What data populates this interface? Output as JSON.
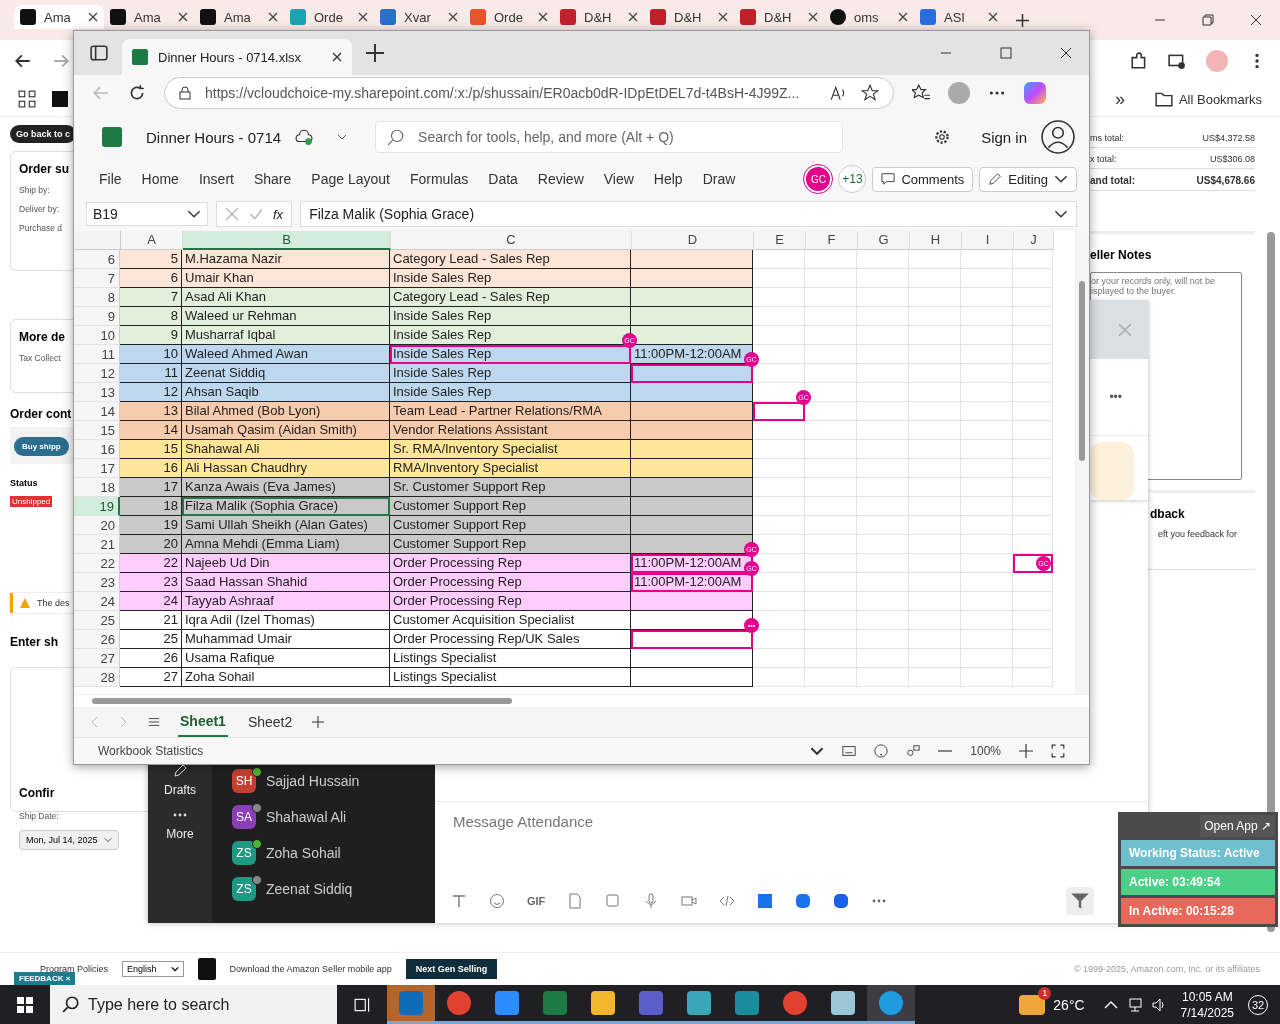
{
  "browser": {
    "tabs": [
      {
        "label": "Ama",
        "selected": true
      },
      {
        "label": "Ama",
        "selected": false
      },
      {
        "label": "Ama",
        "selected": false
      },
      {
        "label": "Orde",
        "selected": false
      },
      {
        "label": "Xvar",
        "selected": false
      },
      {
        "label": "Orde",
        "selected": false
      },
      {
        "label": "D&H",
        "selected": false
      },
      {
        "label": "D&H",
        "selected": false
      },
      {
        "label": "D&H",
        "selected": false
      },
      {
        "label": "oms",
        "selected": false
      },
      {
        "label": "ASI",
        "selected": false
      }
    ],
    "bookmarks_overflow": "»",
    "bookmarks_folder": "All Bookmarks"
  },
  "amazon": {
    "back_button": "Go back to c",
    "order_summary": {
      "title": "Order su",
      "fields": [
        "Ship by:",
        "Deliver by:",
        "Purchase d"
      ]
    },
    "more_details": {
      "title": "More de",
      "fields": [
        "Tax Collect"
      ]
    },
    "order_contents": {
      "title": "Order cont",
      "button": "Buy shipp",
      "status_label": "Status",
      "status": "Unshipped"
    },
    "alert": "The des",
    "enter_shipping": "Enter sh",
    "confirm": {
      "title": "Confir",
      "ship_date_label": "Ship Date:",
      "ship_date": "Mon, Jul 14, 2025"
    },
    "totals": [
      {
        "label": "ms total:",
        "value": "US$4,372.58",
        "bold": false
      },
      {
        "label": "x total:",
        "value": "US$306.08",
        "bold": false
      },
      {
        "label": "and total:",
        "value": "US$4,678.66",
        "bold": true
      }
    ],
    "seller_notes": {
      "title": "eller Notes",
      "placeholder": "or your records only, will not be\nisplayed to the buyer."
    },
    "feedback": {
      "title": "dback",
      "text": "eft you feedback for"
    },
    "footer": {
      "links": [
        "Program Policies"
      ],
      "language": "English",
      "app_link": "Download the Amazon Seller mobile app",
      "next_gen": "Next Gen Selling",
      "feedback_tab": "FEEDBACK ×",
      "copyright": "© 1999-2025, Amazon.com, Inc. or its affiliates"
    }
  },
  "edge": {
    "tab": "Dinner Hours - 0714.xlsx",
    "url": "https://vcloudchoice-my.sharepoint.com/:x:/p/shussain/ER0acb0dR-IDpEtDEL7d-t4BsH-4J99Z..."
  },
  "excel": {
    "title": "Dinner Hours - 0714",
    "search": {
      "placeholder": "Search for tools, help, and more (Alt + Q)"
    },
    "sign_in": "Sign in",
    "menu": [
      "File",
      "Home",
      "Insert",
      "Share",
      "Page Layout",
      "Formulas",
      "Data",
      "Review",
      "View",
      "Help",
      "Draw"
    ],
    "collaborator": "GC",
    "others": "+13",
    "comments": "Comments",
    "editing": "Editing",
    "name_box": "B19",
    "fx": "fx",
    "formula": "Filza Malik (Sophia Grace)",
    "columns": [
      {
        "label": "A",
        "selected": false
      },
      {
        "label": "B",
        "selected": true
      },
      {
        "label": "C",
        "selected": false
      },
      {
        "label": "D",
        "selected": false
      },
      {
        "label": "E",
        "selected": false
      },
      {
        "label": "F",
        "selected": false
      },
      {
        "label": "G",
        "selected": false
      },
      {
        "label": "H",
        "selected": false
      },
      {
        "label": "I",
        "selected": false
      },
      {
        "label": "J",
        "selected": false
      }
    ],
    "rows": [
      {
        "number": "6",
        "a": "5",
        "b": "M.Hazama Nazir",
        "c": "Category Lead - Sales Rep",
        "color": "#fce4d6",
        "selected": false
      },
      {
        "number": "7",
        "a": "6",
        "b": "Umair Khan",
        "c": "Inside Sales Rep",
        "color": "#fce4d6",
        "selected": false
      },
      {
        "number": "8",
        "a": "7",
        "b": "Asad Ali Khan",
        "c": "Category Lead - Sales Rep",
        "color": "#e2efda",
        "selected": false
      },
      {
        "number": "9",
        "a": "8",
        "b": "Waleed ur Rehman",
        "c": "Inside Sales Rep",
        "color": "#e2efda",
        "selected": false
      },
      {
        "number": "10",
        "a": "9",
        "b": "Musharraf Iqbal",
        "c": "Inside Sales Rep",
        "color": "#e2efda",
        "selected": false
      },
      {
        "number": "11",
        "a": "10",
        "b": "Waleed Ahmed Awan",
        "c": "Inside Sales Rep",
        "d": "11:00PM-12:00AM",
        "color": "#bdd7ee",
        "selected": false,
        "cursor_c": "GC"
      },
      {
        "number": "12",
        "a": "11",
        "b": "Zeenat Siddiq",
        "c": "Inside Sales Rep",
        "color": "#bdd7ee",
        "selected": false,
        "cursor_d": "GC"
      },
      {
        "number": "13",
        "a": "12",
        "b": "Ahsan Saqib",
        "c": "Inside Sales Rep",
        "color": "#bdd7ee",
        "selected": false
      },
      {
        "number": "14",
        "a": "13",
        "b": "Bilal Ahmed (Bob Lyon)",
        "c": "Team Lead - Partner Relations/RMA",
        "color": "#f8cbad",
        "selected": false,
        "cursor_e": "GC"
      },
      {
        "number": "15",
        "a": "14",
        "b": "Usamah Qasim (Aidan Smith)",
        "c": "Vendor Relations Assistant",
        "color": "#f8cbad",
        "selected": false
      },
      {
        "number": "16",
        "a": "15",
        "b": "Shahawal Ali",
        "c": "Sr. RMA/Inventory Specialist",
        "color": "#ffe699",
        "selected": false
      },
      {
        "number": "17",
        "a": "16",
        "b": "Ali Hassan Chaudhry",
        "c": "RMA/Inventory Specialist",
        "color": "#ffe699",
        "selected": false
      },
      {
        "number": "18",
        "a": "17",
        "b": "Kanza Awais (Eva James)",
        "c": "Sr. Customer Support Rep",
        "color": "#c9c9c9",
        "selected": false
      },
      {
        "number": "19",
        "a": "18",
        "b": "Filza Malik (Sophia Grace)",
        "c": "Customer Support Rep",
        "color": "#c9c9c9",
        "selected": true
      },
      {
        "number": "20",
        "a": "19",
        "b": "Sami Ullah Sheikh (Alan Gates)",
        "c": "Customer Support Rep",
        "color": "#c9c9c9",
        "selected": false
      },
      {
        "number": "21",
        "a": "20",
        "b": "Amna Mehdi (Emma Liam)",
        "c": "Customer Support Rep",
        "color": "#c9c9c9",
        "selected": false
      },
      {
        "number": "22",
        "a": "22",
        "b": "Najeeb Ud Din",
        "c": "Order Processing Rep",
        "d": "11:00PM-12:00AM",
        "color": "#ffccff",
        "selected": false,
        "cursor_d": "GC",
        "cursor_j": "GC"
      },
      {
        "number": "23",
        "a": "23",
        "b": "Saad Hassan Shahid",
        "c": "Order Processing Rep",
        "d": "11:00PM-12:00AM",
        "color": "#ffccff",
        "selected": false,
        "cursor_d": "GC"
      },
      {
        "number": "24",
        "a": "24",
        "b": "Tayyab Ashraaf",
        "c": "Order Processing Rep",
        "color": "#ffccff",
        "selected": false
      },
      {
        "number": "25",
        "a": "21",
        "b": "Iqra Adil (Izel Thomas)",
        "c": "Customer Acquisition Specialist",
        "color": "#ffffff",
        "selected": false
      },
      {
        "number": "26",
        "a": "25",
        "b": "Muhammad Umair",
        "c": "Order Processing Rep/UK Sales",
        "color": "#ffffff",
        "selected": false,
        "cursor_d": "•••"
      },
      {
        "number": "27",
        "a": "26",
        "b": "Usama Rafique",
        "c": "Listings Specialist",
        "color": "#ffffff",
        "selected": false
      },
      {
        "number": "28",
        "a": "27",
        "b": "Zoha Sohail",
        "c": "Listings Specialist",
        "color": "#ffffff",
        "selected": false
      }
    ],
    "sheets": [
      {
        "label": "Sheet1",
        "selected": true
      },
      {
        "label": "Sheet2",
        "selected": false
      }
    ],
    "status": "Workbook Statistics",
    "zoom": "100%"
  },
  "teams": {
    "nav": [
      "Drafts",
      "More"
    ],
    "contacts": [
      {
        "initials": "SH",
        "name": "Sajjad Hussain",
        "color": "#c4402f",
        "available": true
      },
      {
        "initials": "SA",
        "name": "Shahawal Ali",
        "color": "#8a3fb8",
        "available": false
      },
      {
        "initials": "ZS",
        "name": "Zoha Sohail",
        "color": "#1e9a84",
        "available": true
      },
      {
        "initials": "ZS",
        "name": "Zeenat Siddiq",
        "color": "#1e9a84",
        "available": false
      }
    ],
    "composer": {
      "placeholder": "Message Attendance"
    },
    "gif": "GIF",
    "more": "•••"
  },
  "attendance": {
    "open": "Open App ↗",
    "status": "Working Status: Active",
    "active": "Active: 03:49:54",
    "inactive": "In Active: 00:15:28"
  },
  "taskbar": {
    "search": {
      "placeholder": "Type here to search"
    },
    "apps": [
      {
        "kind": "mail",
        "selected": false,
        "highlighted": true
      },
      {
        "kind": "browser",
        "selected": false,
        "highlighted": false
      },
      {
        "kind": "video",
        "selected": false,
        "highlighted": false
      },
      {
        "kind": "sheet",
        "selected": false,
        "highlighted": false
      },
      {
        "kind": "folder",
        "selected": false,
        "highlighted": false
      },
      {
        "kind": "chat",
        "selected": false,
        "highlighted": false
      },
      {
        "kind": "cube",
        "selected": false,
        "highlighted": false
      },
      {
        "kind": "shield",
        "selected": false,
        "highlighted": false
      },
      {
        "kind": "browser",
        "selected": false,
        "highlighted": false
      },
      {
        "kind": "notepad",
        "selected": false,
        "highlighted": false
      },
      {
        "kind": "edge",
        "selected": true,
        "highlighted": false
      }
    ],
    "weather_badge": "1",
    "temperature": "26°C",
    "time": "10:05 AM",
    "date": "7/14/2025",
    "notifications": "32"
  }
}
